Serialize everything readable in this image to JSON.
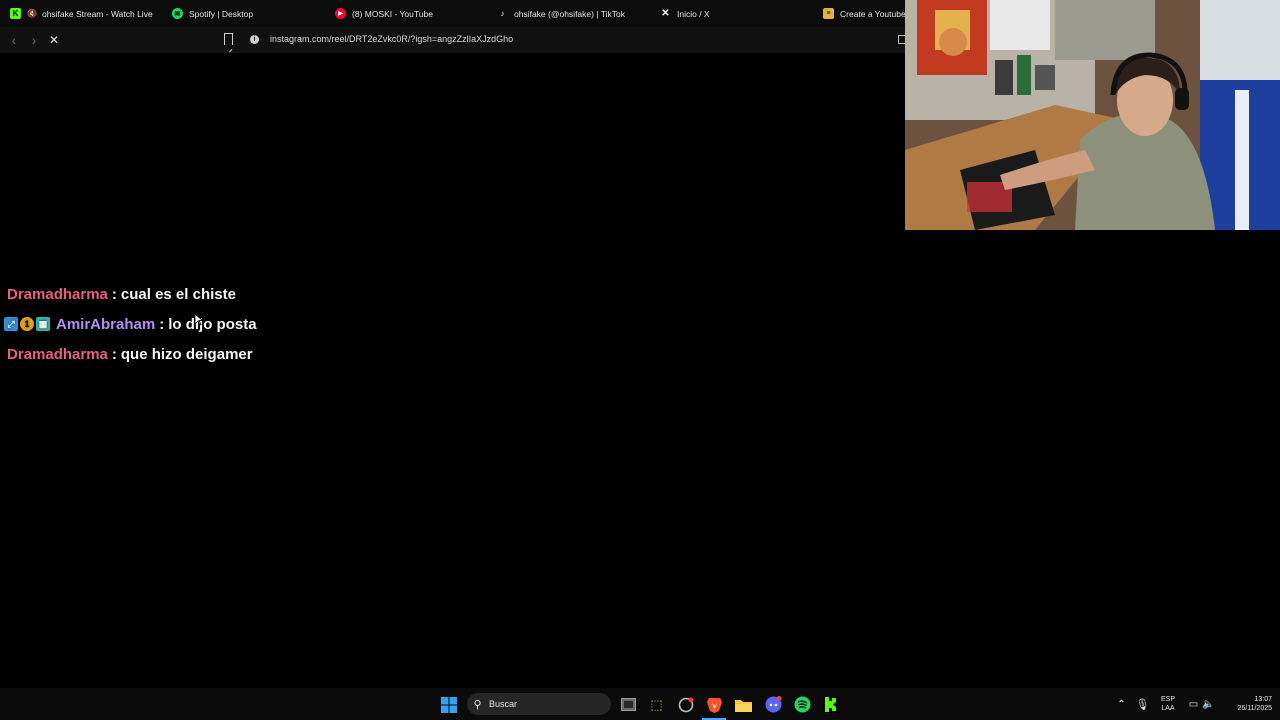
{
  "tabs": [
    {
      "label": "ohsifake Stream - Watch Live on",
      "icon": "kick-icon",
      "color": "#53fc18"
    },
    {
      "label": "Spotify | Desktop",
      "icon": "spotify-icon",
      "color": "#1ed760"
    },
    {
      "label": "(8) MOSKI - YouTube",
      "icon": "youtube-icon",
      "color": "#ff0033"
    },
    {
      "label": "ohsifake (@ohsifake) | TikTok",
      "icon": "tiktok-icon",
      "color": "#ffffff"
    },
    {
      "label": "Inicio / X",
      "icon": "x-icon",
      "color": "#ffffff"
    },
    {
      "label": "Create a Youtubers",
      "icon": "document-icon",
      "color": "#e0b341"
    }
  ],
  "address_bar": {
    "url": "instagram.com/reel/DRT2eZvkc0R/?igsh=angzZzlIaXJzdGho"
  },
  "chat": [
    {
      "user": "Dramadharma",
      "sep": ":",
      "text": "cual es el chiste",
      "color": "#e6607e",
      "badges": []
    },
    {
      "user": "AmirAbraham",
      "sep": ":",
      "text": "lo dijo posta",
      "color": "#b58cf0",
      "badges": [
        "pin-badge-icon",
        "number-one-badge-icon",
        "grid-badge-icon"
      ]
    },
    {
      "user": "Dramadharma",
      "sep": ":",
      "text": "que hizo deigamer",
      "color": "#e6607e",
      "badges": []
    }
  ],
  "taskbar": {
    "search_placeholder": "Buscar",
    "language_top": "ESP",
    "language_bottom": "LAA",
    "time": "13:07",
    "date": "26/11/2025"
  }
}
